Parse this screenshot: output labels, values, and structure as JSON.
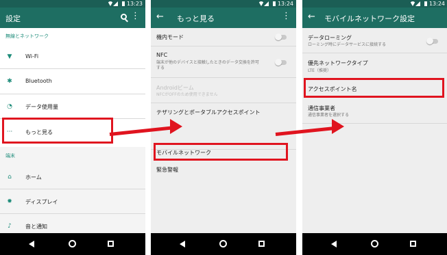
{
  "statusbar": {
    "p1_time": "13:23",
    "p2_time": "13:24",
    "p3_time": "13:24"
  },
  "panel1": {
    "title": "設定",
    "section_wireless": "無線とネットワーク",
    "section_device": "端末",
    "items": [
      "Wi-Fi",
      "Bluetooth",
      "データ使用量",
      "もっと見る",
      "ホーム",
      "ディスプレイ",
      "音と通知"
    ]
  },
  "panel2": {
    "title": "もっと見る",
    "airplane": "機内モード",
    "nfc": "NFC",
    "nfc_sub": "端末が他のデバイスと接触したときのデータ交換を許可する",
    "beam": "Androidビーム",
    "beam_sub": "NFCがOFFのため使用できません",
    "tethering": "テザリングとポータブルアクセスポイント",
    "mobile_network": "モバイルネットワーク",
    "emergency": "緊急警報"
  },
  "panel3": {
    "title": "モバイルネットワーク設定",
    "roaming": "データローミング",
    "roaming_sub": "ローミング時にデータサービスに接続する",
    "preferred": "優先ネットワークタイプ",
    "preferred_sub": "LTE（推奨）",
    "apn": "アクセスポイント名",
    "carrier": "通信事業者",
    "carrier_sub": "通信事業者を選択する"
  },
  "colors": {
    "appbar": "#1e6e62",
    "statusbar": "#1b5e55",
    "accent": "#1e8c7a",
    "highlight": "#e0141f"
  }
}
